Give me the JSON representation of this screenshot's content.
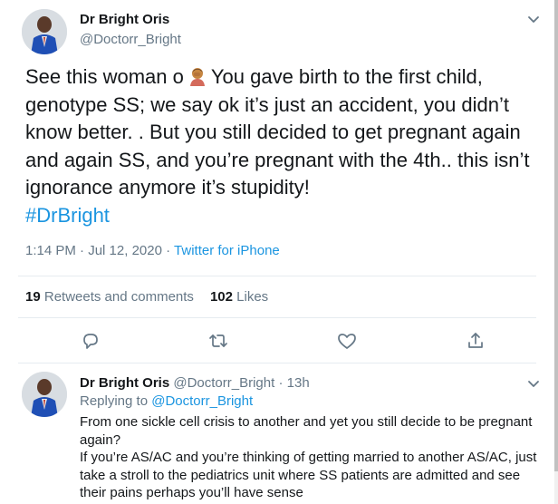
{
  "tweet": {
    "author_name": "Dr Bright Oris",
    "author_handle": "@Doctorr_Bright",
    "text": "See this woman o",
    "emoji": "facepalm-emoji",
    "text_after_emoji": "You gave birth to the first child, genotype SS; we say ok it’s just an accident, you didn’t know better. . But you still decided to get pregnant again and again SS, and you’re pregnant with the 4th.. this isn’t ignorance anymore it’s stupidity!",
    "hashtag": "#DrBright",
    "time": "1:14 PM",
    "separator": "·",
    "date": "Jul 12, 2020",
    "source_separator": "·",
    "source": "Twitter for iPhone"
  },
  "stats": {
    "retweets_count": "19",
    "retweets_label": "Retweets and comments",
    "likes_count": "102",
    "likes_label": "Likes"
  },
  "reply": {
    "author_name": "Dr Bright Oris",
    "author_handle": "@Doctorr_Bright",
    "separator": "·",
    "time_ago": "13h",
    "replying_label": "Replying to",
    "replying_to": "@Doctorr_Bright",
    "line1": "From one sickle cell crisis to another and yet you still decide to be pregnant again?",
    "line2": "If you’re AS/AC and you’re thinking of getting married to another AS/AC, just take a stroll to the pediatrics unit where SS patients are admitted and see their pains perhaps you’ll have sense"
  },
  "colors": {
    "link": "#1b95e0",
    "secondary_text": "#657786",
    "primary_text": "#14171a",
    "divider": "#e6ecf0"
  },
  "icons": [
    "chevron-down-icon",
    "reply-icon",
    "retweet-icon",
    "like-icon",
    "share-icon"
  ]
}
